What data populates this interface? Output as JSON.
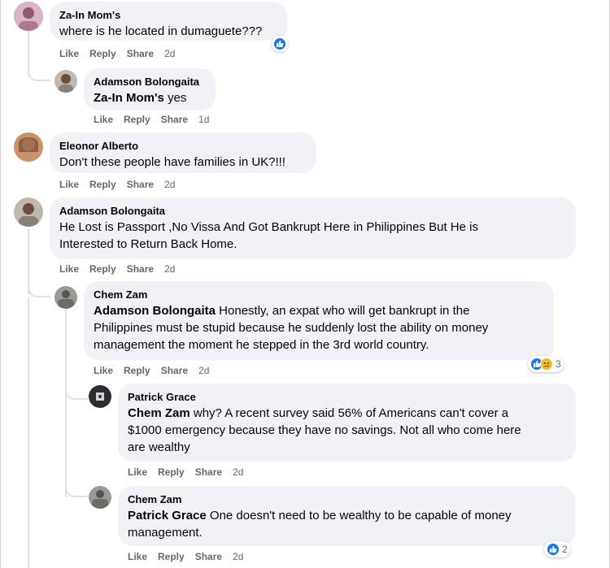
{
  "actions": {
    "like": "Like",
    "reply": "Reply",
    "share": "Share"
  },
  "comments": [
    {
      "name": "Za-In Mom's",
      "mention": "",
      "text": "where is he located in dumaguete???",
      "time": "2d"
    },
    {
      "name": "Adamson Bolongaita",
      "mention": "Za-In Mom's",
      "text": " yes",
      "time": "1d"
    },
    {
      "name": "Eleonor Alberto",
      "mention": "",
      "text": "Don't these people have families in UK?!!!",
      "time": "2d"
    },
    {
      "name": "Adamson Bolongaita",
      "mention": "",
      "text_lines": [
        "He Lost is Passport ,No Vissa And Got Bankrupt Here in Philippines But He is",
        "Interested to Return Back Home."
      ],
      "time": "2d"
    },
    {
      "name": "Chem Zam",
      "mention": "Adamson Bolongaita",
      "text_lines": [
        " Honestly, an expat who will get bankrupt in the",
        "Philippines must be stupid because he suddenly lost the ability on money",
        "management the moment he stepped in the 3rd world country."
      ],
      "time": "2d",
      "reaction_count": "3"
    },
    {
      "name": "Patrick Grace",
      "mention": "Chem Zam",
      "text_lines": [
        " why? A recent survey said 56% of Americans can't cover a",
        "$1000 emergency because they have no savings. Not all who come here",
        "are wealthy"
      ],
      "time": "2d"
    },
    {
      "name": "Chem Zam",
      "mention": "Patrick Grace",
      "text_lines": [
        " One doesn't need to be wealthy to be capable of money",
        "management."
      ],
      "time": "2d",
      "reaction_count": "2"
    }
  ],
  "colors": {
    "bubble": "#f0f2f5",
    "meta": "#65676b",
    "like_blue": "#1877f2",
    "sad_yellow": "#f7b928"
  }
}
